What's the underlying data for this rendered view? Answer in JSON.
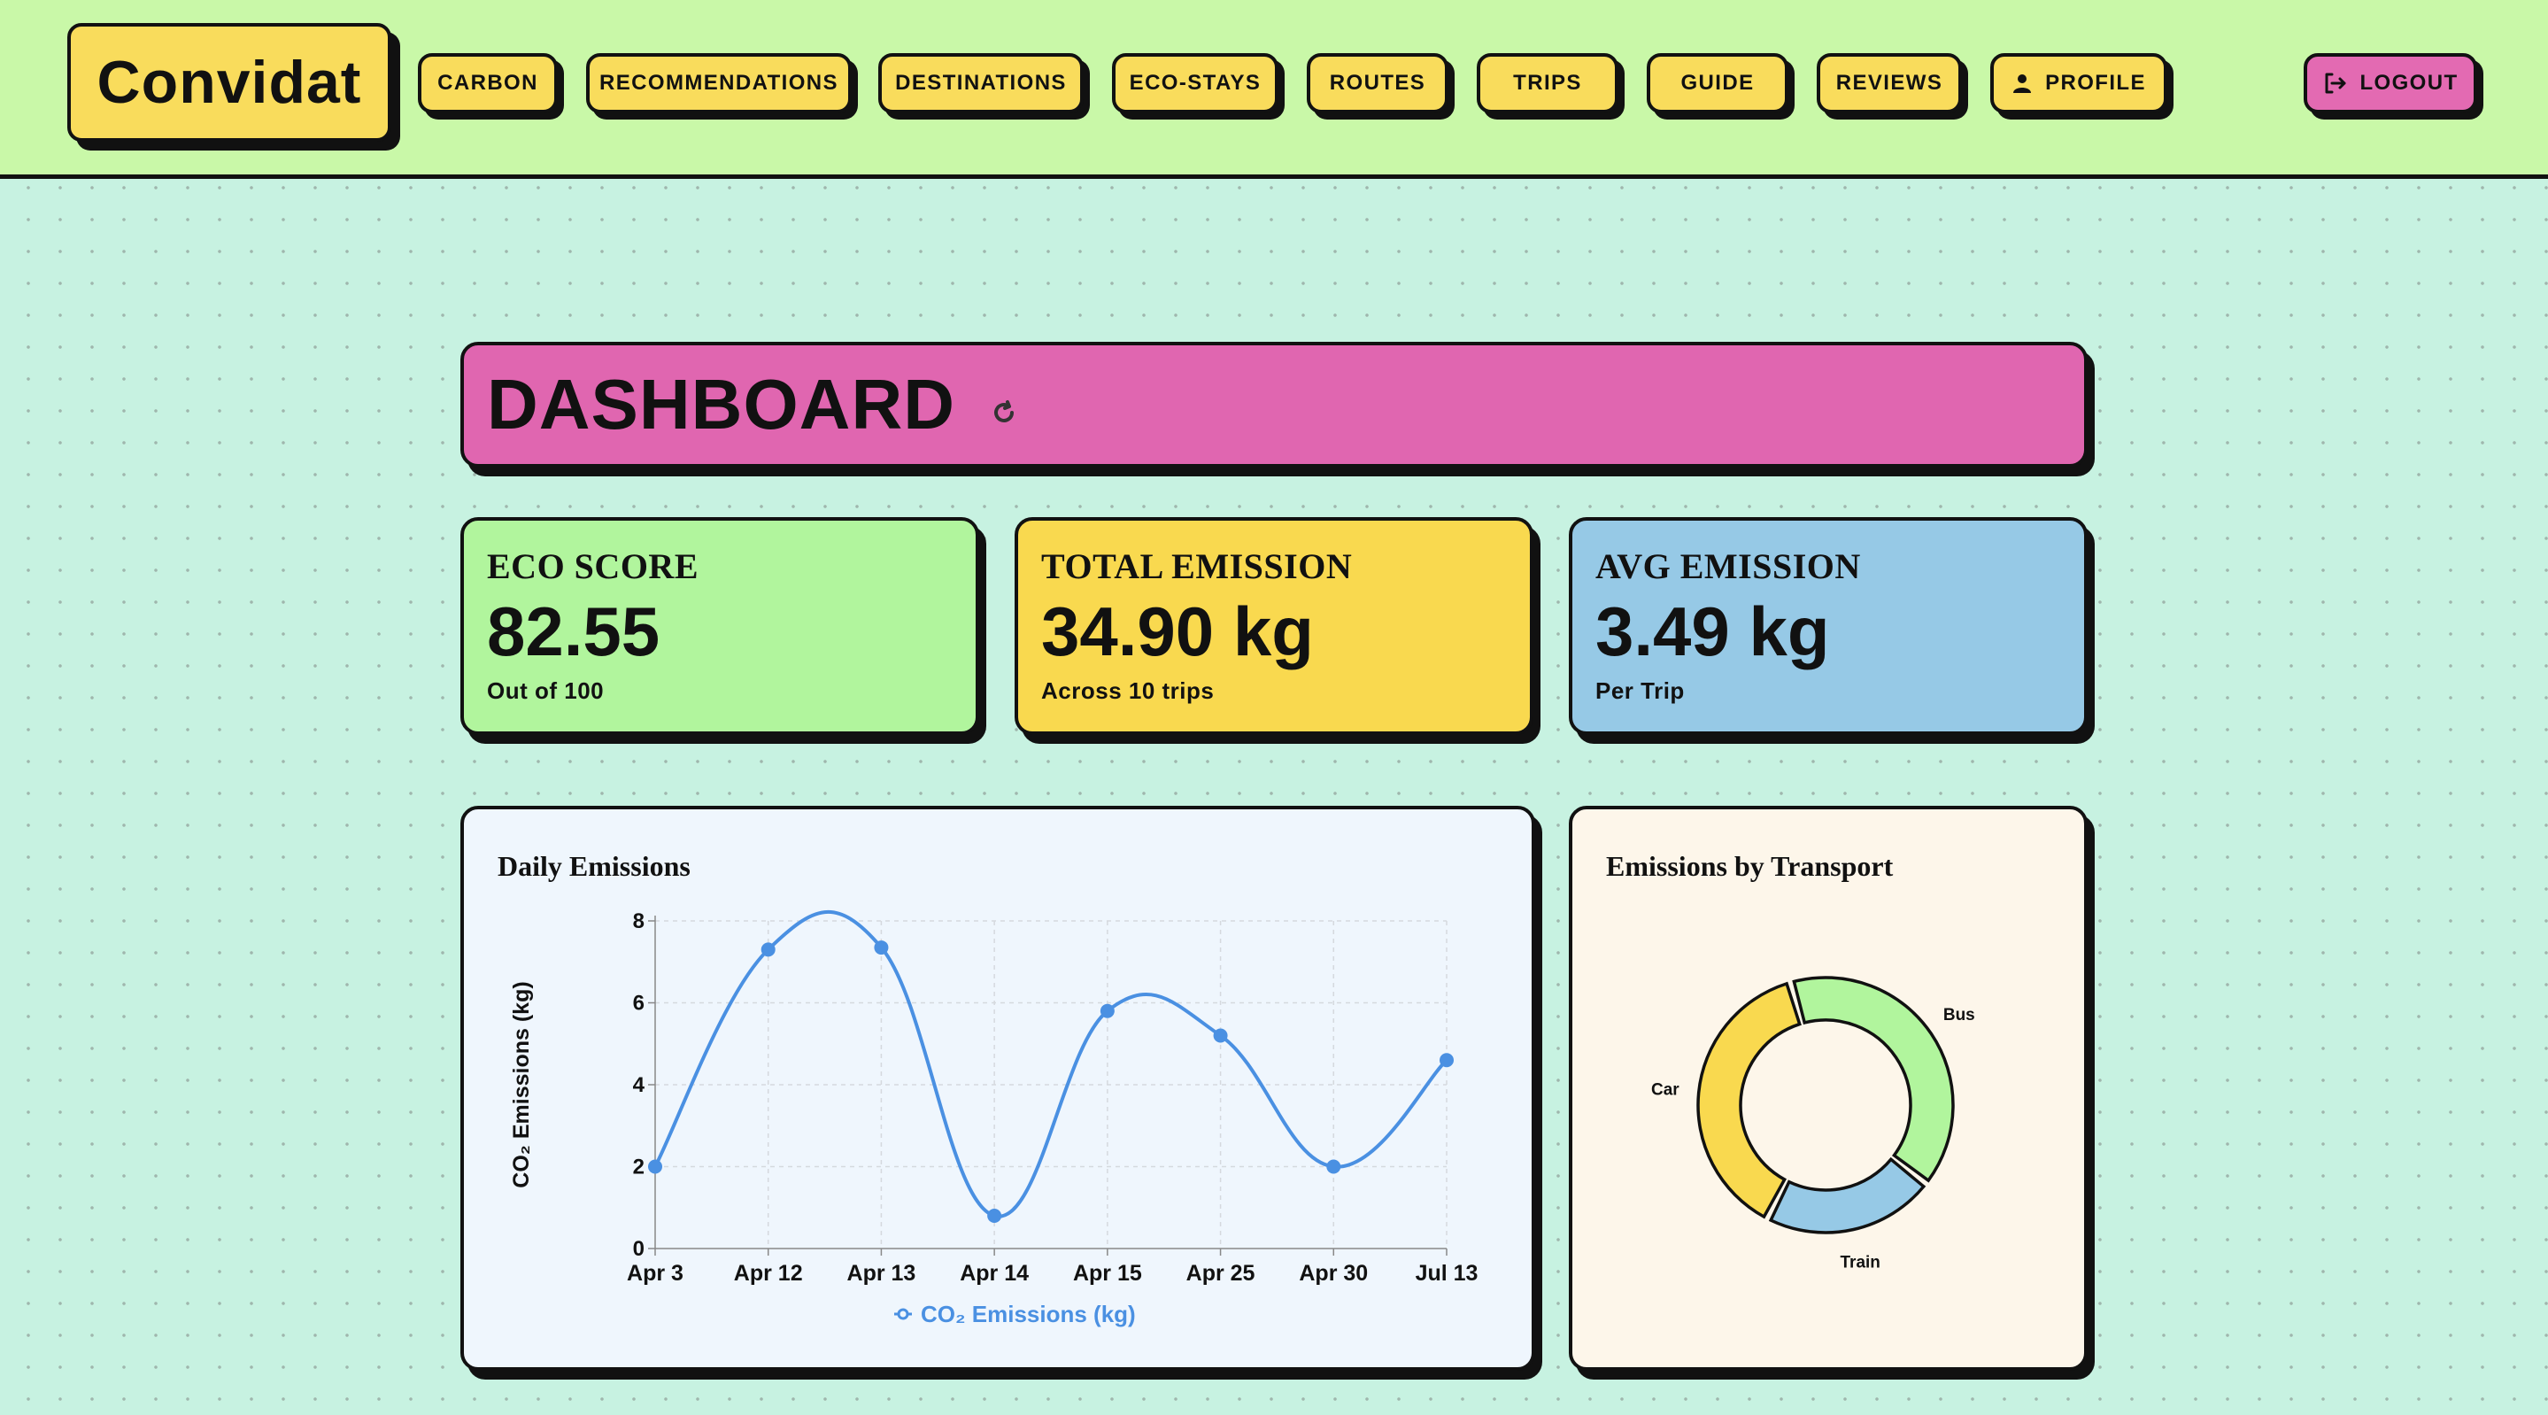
{
  "app": {
    "logo": "Convidat"
  },
  "nav": {
    "items": [
      {
        "label": "CARBON"
      },
      {
        "label": "RECOMMENDATIONS"
      },
      {
        "label": "DESTINATIONS"
      },
      {
        "label": "ECO-STAYS"
      },
      {
        "label": "ROUTES"
      },
      {
        "label": "TRIPS"
      },
      {
        "label": "GUIDE"
      },
      {
        "label": "REVIEWS"
      },
      {
        "label": "PROFILE",
        "icon": "user-icon"
      }
    ],
    "logout": {
      "label": "LOGOUT",
      "icon": "logout-icon"
    }
  },
  "banner": {
    "title": "DASHBOARD",
    "icon": "refresh-icon"
  },
  "stats": [
    {
      "label": "ECO SCORE",
      "value": "82.55",
      "sub": "Out of 100",
      "color": "#b1f59d"
    },
    {
      "label": "TOTAL EMISSION",
      "value": "34.90 kg",
      "sub": "Across 10 trips",
      "color": "#f9d94f"
    },
    {
      "label": "AVG EMISSION",
      "value": "3.49 kg",
      "sub": "Per Trip",
      "color": "#96c9e6"
    }
  ],
  "colors": {
    "line": "#4a90e2",
    "daily_panel_bg": "#eff6fd",
    "transport_panel_bg": "#fdf6ea"
  },
  "chart_data": [
    {
      "type": "line",
      "title": "Daily Emissions",
      "ylabel": "CO₂ Emissions (kg)",
      "xlabel": "",
      "categories": [
        "Apr 3",
        "Apr 12",
        "Apr 13",
        "Apr 14",
        "Apr 15",
        "Apr 25",
        "Apr 30",
        "Jul 13"
      ],
      "series": [
        {
          "name": "CO₂ Emissions (kg)",
          "values": [
            2.0,
            7.3,
            7.35,
            0.8,
            5.8,
            5.2,
            2.0,
            4.6
          ]
        }
      ],
      "ylim": [
        0,
        8
      ],
      "yticks": [
        "0",
        "2",
        "4",
        "6",
        "8"
      ],
      "grid": true,
      "legend": "bottom"
    },
    {
      "type": "pie",
      "title": "Emissions by Transport",
      "labels": [
        "Bus",
        "Train",
        "Car"
      ],
      "values": [
        40,
        22,
        38
      ],
      "colors": [
        "#b1f59d",
        "#96c9e6",
        "#f9d94f"
      ],
      "donut": true
    }
  ]
}
